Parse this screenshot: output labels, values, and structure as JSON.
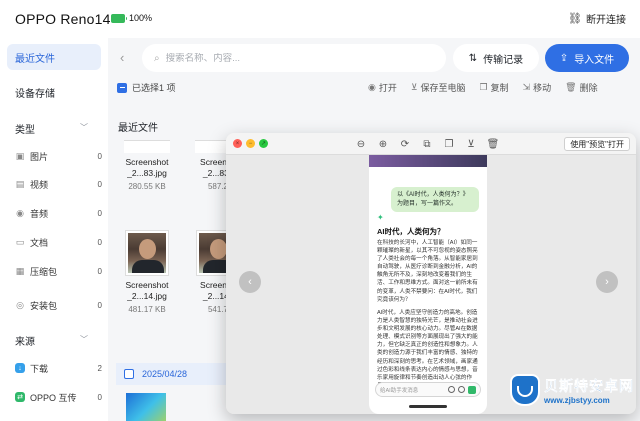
{
  "header": {
    "device_name": "OPPO Reno14",
    "battery": "100%",
    "disconnect_label": "断开连接"
  },
  "sidebar": {
    "recent_files": "最近文件",
    "device_storage": "设备存储",
    "type_section": "类型",
    "types": [
      {
        "label": "图片",
        "count": "0",
        "icon": "image-icon"
      },
      {
        "label": "视频",
        "count": "0",
        "icon": "video-icon"
      },
      {
        "label": "音频",
        "count": "0",
        "icon": "audio-icon"
      },
      {
        "label": "文档",
        "count": "0",
        "icon": "document-icon"
      },
      {
        "label": "压缩包",
        "count": "0",
        "icon": "archive-icon"
      },
      {
        "label": "安装包",
        "count": "0",
        "icon": "package-icon"
      }
    ],
    "source_section": "来源",
    "sources": [
      {
        "label": "下载",
        "count": "2",
        "icon": "download-icon"
      },
      {
        "label": "OPPO 互传",
        "count": "0",
        "icon": "oppo-share-icon"
      }
    ]
  },
  "toolbar": {
    "search_placeholder": "搜索名称、内容...",
    "transfer_record": "传输记录",
    "import_file": "导入文件",
    "selected_text": "已选择1 项",
    "actions": [
      "打开",
      "保存至电脑",
      "复制",
      "移动",
      "删除"
    ]
  },
  "recent": {
    "title": "最近文件",
    "files": [
      {
        "name_line1": "Screenshot",
        "name_line2": "_2...83.jpg",
        "size": "280.55 KB"
      },
      {
        "name_line1": "Screensh",
        "name_line2": "_2...83.j",
        "size": "587.2"
      },
      {
        "name_line1": "Screenshot",
        "name_line2": "_2...14.jpg",
        "size": "481.17 KB"
      },
      {
        "name_line1": "Screensh",
        "name_line2": "_2...14.j",
        "size": "541.7"
      }
    ],
    "date_group": "2025/04/28"
  },
  "preview": {
    "open_with": "使用\"预览\"打开",
    "status_time": "",
    "question": "以《AI时代，人类何为？》为题目，写一篇作文。",
    "answer_title": "AI时代，人类何为？",
    "paragraph1": "在科技的长河中，人工智能（AI）如同一颗璀璨的新星，以其不可忽视的姿态照亮了人类社会的每一个角落。从智能家居到自动驾驶，从医疗诊断到金融分析，AI的触角无所不及，深刻地改变着我们的生活、工作和思维方式。面对这一前所未有的变革，人类不禁要问：在AI时代，我们究竟该何为？",
    "paragraph2": "AI时代，人类应坚守创造力的高地。创造力是人类智慧的独特光芒，是推动社会进步和文明发展的核心动力。尽管AI在数据处理、模式识别等方面展现出了强大的能力，但它缺乏真正的创造性和想象力。人类的创造力源于我们丰富的情感、独特的经历和深刻的思考。在艺术领域，画家通过色彩和线条表达内心的情感与思想，音乐家用旋律和节奏创造出动人心弦的作品，作家用文字构建出奇妙的世界。",
    "input_placeholder": "给AI助手发消息"
  },
  "watermark": {
    "brand": "贝斯特安卓网",
    "url": "www.zjbstyy.com"
  }
}
